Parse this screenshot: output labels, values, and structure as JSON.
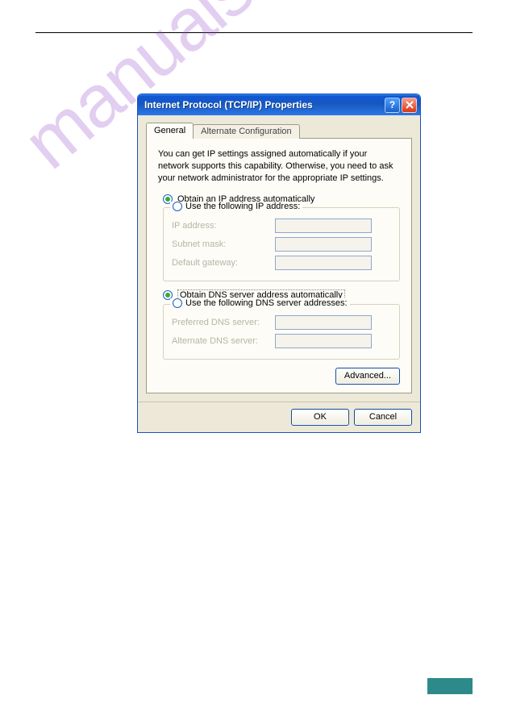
{
  "watermark": "manualshive.com",
  "dialog": {
    "title": "Internet Protocol (TCP/IP) Properties",
    "tabs": {
      "general": "General",
      "alt": "Alternate Configuration"
    },
    "desc": "You can get IP settings assigned automatically if your network supports this capability. Otherwise, you need to ask your network administrator for the appropriate IP settings.",
    "radio_obtain_ip": "Obtain an IP address automatically",
    "radio_use_ip": "Use the following IP address:",
    "fields_ip": {
      "ip": "IP address:",
      "subnet": "Subnet mask:",
      "gateway": "Default gateway:"
    },
    "radio_obtain_dns": "Obtain DNS server address automatically",
    "radio_use_dns": "Use the following DNS server addresses:",
    "fields_dns": {
      "pref": "Preferred DNS server:",
      "alt": "Alternate DNS server:"
    },
    "buttons": {
      "advanced": "Advanced...",
      "ok": "OK",
      "cancel": "Cancel"
    },
    "help_glyph": "?"
  }
}
